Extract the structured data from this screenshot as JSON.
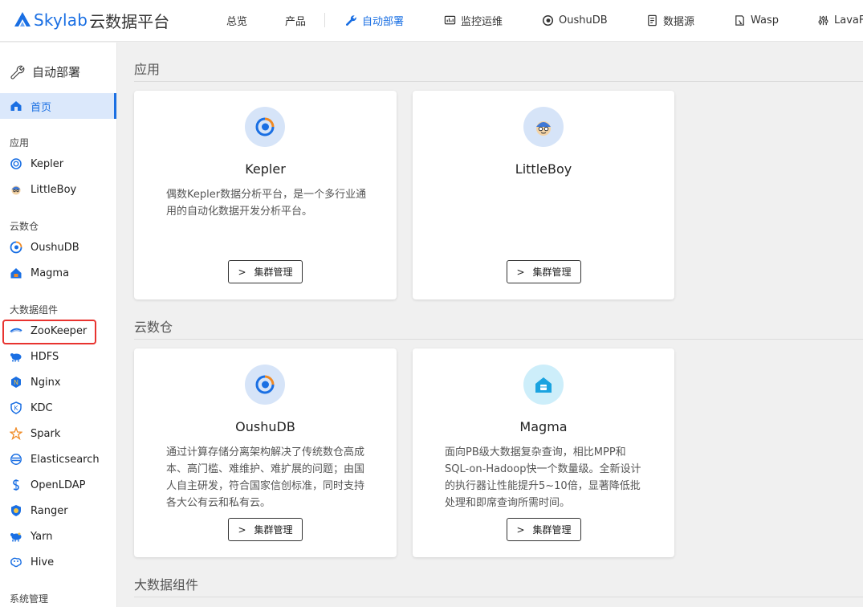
{
  "header": {
    "logo_text": "Skylab",
    "logo_suffix": "云数据平台",
    "nav": [
      {
        "label": "总览",
        "icon": "none"
      },
      {
        "label": "产品",
        "icon": "none"
      },
      {
        "label": "自动部署",
        "icon": "wrench-icon",
        "active": true
      },
      {
        "label": "监控运维",
        "icon": "monitor-icon"
      },
      {
        "label": "OushuDB",
        "icon": "oushudb-icon"
      },
      {
        "label": "数据源",
        "icon": "document-icon"
      },
      {
        "label": "Wasp",
        "icon": "wasp-icon"
      },
      {
        "label": "LavaF",
        "icon": "sliders-icon"
      }
    ]
  },
  "sidebar": {
    "title": "自动部署",
    "home": "首页",
    "groups": [
      {
        "label": "应用",
        "items": [
          "Kepler",
          "LittleBoy"
        ]
      },
      {
        "label": "云数仓",
        "items": [
          "OushuDB",
          "Magma"
        ]
      },
      {
        "label": "大数据组件",
        "items": [
          "ZooKeeper",
          "HDFS",
          "Nginx",
          "KDC",
          "Spark",
          "Elasticsearch",
          "OpenLDAP",
          "Ranger",
          "Yarn",
          "Hive"
        ]
      },
      {
        "label": "系统管理",
        "items": []
      }
    ]
  },
  "main": {
    "sections": [
      {
        "title": "应用",
        "cards": [
          {
            "name": "Kepler",
            "desc": "偶数Kepler数据分析平台，是一个多行业通用的自动化数据开发分析平台。",
            "button": "集群管理"
          },
          {
            "name": "LittleBoy",
            "desc": "",
            "button": "集群管理"
          }
        ]
      },
      {
        "title": "云数仓",
        "cards": [
          {
            "name": "OushuDB",
            "desc": "通过计算存储分离架构解决了传统数仓高成本、高门槛、难维护、难扩展的问题；由国人自主研发，符合国家信创标准，同时支持各大公有云和私有云。",
            "button": "集群管理"
          },
          {
            "name": "Magma",
            "desc": "面向PB级大数据复杂查询，相比MPP和SQL-on-Hadoop快一个数量级。全新设计的执行器让性能提升5~10倍，显著降低批处理和即席查询所需时间。",
            "button": "集群管理"
          }
        ]
      },
      {
        "title": "大数据组件",
        "cards": []
      }
    ]
  },
  "colors": {
    "accent": "#1a6fe3",
    "highlight_border": "#e8332f"
  }
}
